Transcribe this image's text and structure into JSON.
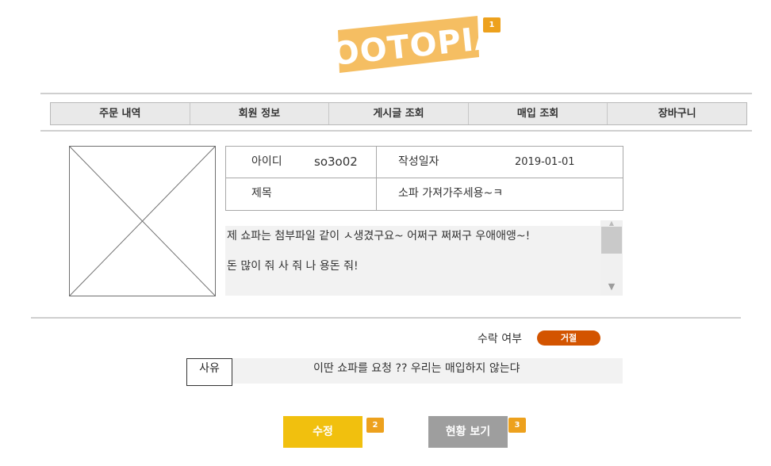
{
  "logo": {
    "text": "JOOTOPIA",
    "badge": "1",
    "color": "#f5be62"
  },
  "nav": {
    "items": [
      "주문 내역",
      "회원 정보",
      "게시글 조회",
      "매입 조회",
      "장바구니"
    ]
  },
  "info": {
    "id_label": "아이디",
    "id_value": "so3o02",
    "date_label": "작성일자",
    "date_value": "2019-01-01",
    "title_label": "제목",
    "title_value": "소파 가져가주세용~ㅋ"
  },
  "content": {
    "line1": "제 쇼파는  첨부파일 같이 ㅅ생겼구요~ 어쩌구 쩌쩌구 우애애앵~!",
    "line2": "돈 많이 줘 사 줘 나 용돈 줘!"
  },
  "approval": {
    "label": "수락 여부",
    "status": "거절",
    "status_color": "#d35400"
  },
  "reason": {
    "label": "사유",
    "text": "이딴 쇼파를 요청 ??  우리는 매입하지 않는댜"
  },
  "buttons": {
    "edit": {
      "label": "수정",
      "badge": "2",
      "color": "#f1c00e"
    },
    "status": {
      "label": "현황 보기",
      "badge": "3",
      "color": "#9e9e9e"
    }
  }
}
